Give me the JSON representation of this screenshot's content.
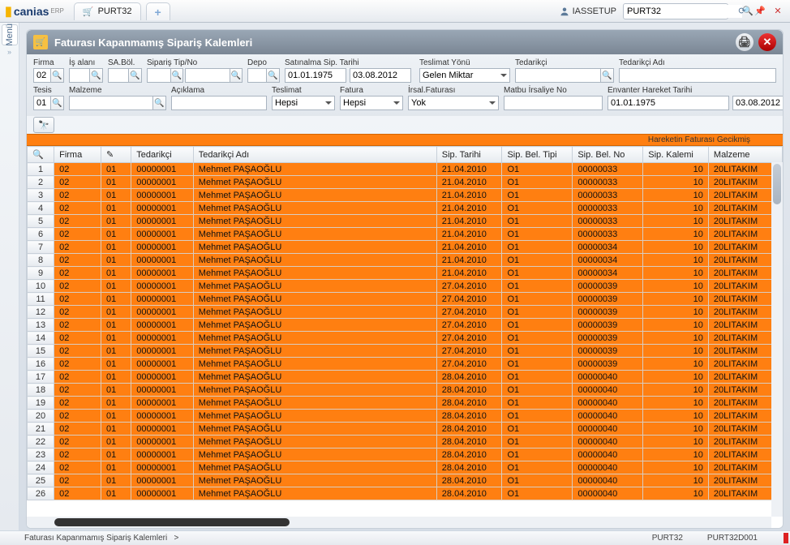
{
  "top": {
    "logo_text": "canias",
    "logo_sup": "ERP",
    "tab_label": "PURT32",
    "user": "IASSETUP",
    "search_value": "PURT32"
  },
  "menu": {
    "label": "Menü"
  },
  "panel": {
    "title": "Faturası Kapanmamış Sipariş Kalemleri"
  },
  "filters": {
    "row1": {
      "firma": {
        "label": "Firma",
        "value": "02"
      },
      "is_alani": {
        "label": "İş alanı",
        "value": ""
      },
      "sabol": {
        "label": "SA.Böl.",
        "value": ""
      },
      "siparis_tip_no": {
        "label": "Sipariş Tip/No",
        "value": ""
      },
      "depo": {
        "label": "Depo",
        "value": ""
      },
      "sat_sip_tarihi": {
        "label": "Satınalma Sip. Tarihi",
        "from": "01.01.1975",
        "to": "03.08.2012"
      },
      "teslimat_yonu": {
        "label": "Teslimat Yönü",
        "value": "Gelen Miktar"
      },
      "tedarikci": {
        "label": "Tedarikçi",
        "value": ""
      },
      "tedarikci_adi": {
        "label": "Tedarikçi Adı",
        "value": ""
      }
    },
    "row2": {
      "tesis": {
        "label": "Tesis",
        "value": "01"
      },
      "malzeme": {
        "label": "Malzeme",
        "value": ""
      },
      "aciklama": {
        "label": "Açıklama",
        "value": ""
      },
      "teslimat": {
        "label": "Teslimat",
        "value": "Hepsi"
      },
      "fatura": {
        "label": "Fatura",
        "value": "Hepsi"
      },
      "irsal_faturasi": {
        "label": "İrsal.Faturası",
        "value": "Yok"
      },
      "matbu_irsaliye_no": {
        "label": "Matbu İrsaliye No",
        "value": ""
      },
      "envanter_hareket_tarihi": {
        "label": "Envanter Hareket Tarihi",
        "from": "01.01.1975",
        "to": "03.08.2012"
      }
    }
  },
  "legend": "Hareketin Faturası Gecikmiş",
  "columns": {
    "firma": "Firma",
    "pencil": "✎",
    "tedarikci": "Tedarikçi",
    "tedarikci_adi": "Tedarikçi Adı",
    "sip_tarihi": "Sip. Tarihi",
    "sip_bel_tipi": "Sip. Bel. Tipi",
    "sip_bel_no": "Sip. Bel. No",
    "sip_kalemi": "Sip. Kalemi",
    "malzeme": "Malzeme"
  },
  "rows": [
    {
      "n": 1,
      "firma": "02",
      "p": "01",
      "ted": "00000001",
      "adi": "Mehmet PAŞAOĞLU",
      "tarih": "21.04.2010",
      "tip": "O1",
      "belno": "00000033",
      "kalem": "10",
      "mal": "20LITAKIM"
    },
    {
      "n": 2,
      "firma": "02",
      "p": "01",
      "ted": "00000001",
      "adi": "Mehmet PAŞAOĞLU",
      "tarih": "21.04.2010",
      "tip": "O1",
      "belno": "00000033",
      "kalem": "10",
      "mal": "20LITAKIM"
    },
    {
      "n": 3,
      "firma": "02",
      "p": "01",
      "ted": "00000001",
      "adi": "Mehmet PAŞAOĞLU",
      "tarih": "21.04.2010",
      "tip": "O1",
      "belno": "00000033",
      "kalem": "10",
      "mal": "20LITAKIM"
    },
    {
      "n": 4,
      "firma": "02",
      "p": "01",
      "ted": "00000001",
      "adi": "Mehmet PAŞAOĞLU",
      "tarih": "21.04.2010",
      "tip": "O1",
      "belno": "00000033",
      "kalem": "10",
      "mal": "20LITAKIM"
    },
    {
      "n": 5,
      "firma": "02",
      "p": "01",
      "ted": "00000001",
      "adi": "Mehmet PAŞAOĞLU",
      "tarih": "21.04.2010",
      "tip": "O1",
      "belno": "00000033",
      "kalem": "10",
      "mal": "20LITAKIM"
    },
    {
      "n": 6,
      "firma": "02",
      "p": "01",
      "ted": "00000001",
      "adi": "Mehmet PAŞAOĞLU",
      "tarih": "21.04.2010",
      "tip": "O1",
      "belno": "00000033",
      "kalem": "10",
      "mal": "20LITAKIM"
    },
    {
      "n": 7,
      "firma": "02",
      "p": "01",
      "ted": "00000001",
      "adi": "Mehmet PAŞAOĞLU",
      "tarih": "21.04.2010",
      "tip": "O1",
      "belno": "00000034",
      "kalem": "10",
      "mal": "20LITAKIM"
    },
    {
      "n": 8,
      "firma": "02",
      "p": "01",
      "ted": "00000001",
      "adi": "Mehmet PAŞAOĞLU",
      "tarih": "21.04.2010",
      "tip": "O1",
      "belno": "00000034",
      "kalem": "10",
      "mal": "20LITAKIM"
    },
    {
      "n": 9,
      "firma": "02",
      "p": "01",
      "ted": "00000001",
      "adi": "Mehmet PAŞAOĞLU",
      "tarih": "21.04.2010",
      "tip": "O1",
      "belno": "00000034",
      "kalem": "10",
      "mal": "20LITAKIM"
    },
    {
      "n": 10,
      "firma": "02",
      "p": "01",
      "ted": "00000001",
      "adi": "Mehmet PAŞAOĞLU",
      "tarih": "27.04.2010",
      "tip": "O1",
      "belno": "00000039",
      "kalem": "10",
      "mal": "20LITAKIM"
    },
    {
      "n": 11,
      "firma": "02",
      "p": "01",
      "ted": "00000001",
      "adi": "Mehmet PAŞAOĞLU",
      "tarih": "27.04.2010",
      "tip": "O1",
      "belno": "00000039",
      "kalem": "10",
      "mal": "20LITAKIM"
    },
    {
      "n": 12,
      "firma": "02",
      "p": "01",
      "ted": "00000001",
      "adi": "Mehmet PAŞAOĞLU",
      "tarih": "27.04.2010",
      "tip": "O1",
      "belno": "00000039",
      "kalem": "10",
      "mal": "20LITAKIM"
    },
    {
      "n": 13,
      "firma": "02",
      "p": "01",
      "ted": "00000001",
      "adi": "Mehmet PAŞAOĞLU",
      "tarih": "27.04.2010",
      "tip": "O1",
      "belno": "00000039",
      "kalem": "10",
      "mal": "20LITAKIM"
    },
    {
      "n": 14,
      "firma": "02",
      "p": "01",
      "ted": "00000001",
      "adi": "Mehmet PAŞAOĞLU",
      "tarih": "27.04.2010",
      "tip": "O1",
      "belno": "00000039",
      "kalem": "10",
      "mal": "20LITAKIM"
    },
    {
      "n": 15,
      "firma": "02",
      "p": "01",
      "ted": "00000001",
      "adi": "Mehmet PAŞAOĞLU",
      "tarih": "27.04.2010",
      "tip": "O1",
      "belno": "00000039",
      "kalem": "10",
      "mal": "20LITAKIM"
    },
    {
      "n": 16,
      "firma": "02",
      "p": "01",
      "ted": "00000001",
      "adi": "Mehmet PAŞAOĞLU",
      "tarih": "27.04.2010",
      "tip": "O1",
      "belno": "00000039",
      "kalem": "10",
      "mal": "20LITAKIM"
    },
    {
      "n": 17,
      "firma": "02",
      "p": "01",
      "ted": "00000001",
      "adi": "Mehmet PAŞAOĞLU",
      "tarih": "28.04.2010",
      "tip": "O1",
      "belno": "00000040",
      "kalem": "10",
      "mal": "20LITAKIM"
    },
    {
      "n": 18,
      "firma": "02",
      "p": "01",
      "ted": "00000001",
      "adi": "Mehmet PAŞAOĞLU",
      "tarih": "28.04.2010",
      "tip": "O1",
      "belno": "00000040",
      "kalem": "10",
      "mal": "20LITAKIM"
    },
    {
      "n": 19,
      "firma": "02",
      "p": "01",
      "ted": "00000001",
      "adi": "Mehmet PAŞAOĞLU",
      "tarih": "28.04.2010",
      "tip": "O1",
      "belno": "00000040",
      "kalem": "10",
      "mal": "20LITAKIM"
    },
    {
      "n": 20,
      "firma": "02",
      "p": "01",
      "ted": "00000001",
      "adi": "Mehmet PAŞAOĞLU",
      "tarih": "28.04.2010",
      "tip": "O1",
      "belno": "00000040",
      "kalem": "10",
      "mal": "20LITAKIM"
    },
    {
      "n": 21,
      "firma": "02",
      "p": "01",
      "ted": "00000001",
      "adi": "Mehmet PAŞAOĞLU",
      "tarih": "28.04.2010",
      "tip": "O1",
      "belno": "00000040",
      "kalem": "10",
      "mal": "20LITAKIM"
    },
    {
      "n": 22,
      "firma": "02",
      "p": "01",
      "ted": "00000001",
      "adi": "Mehmet PAŞAOĞLU",
      "tarih": "28.04.2010",
      "tip": "O1",
      "belno": "00000040",
      "kalem": "10",
      "mal": "20LITAKIM"
    },
    {
      "n": 23,
      "firma": "02",
      "p": "01",
      "ted": "00000001",
      "adi": "Mehmet PAŞAOĞLU",
      "tarih": "28.04.2010",
      "tip": "O1",
      "belno": "00000040",
      "kalem": "10",
      "mal": "20LITAKIM"
    },
    {
      "n": 24,
      "firma": "02",
      "p": "01",
      "ted": "00000001",
      "adi": "Mehmet PAŞAOĞLU",
      "tarih": "28.04.2010",
      "tip": "O1",
      "belno": "00000040",
      "kalem": "10",
      "mal": "20LITAKIM"
    },
    {
      "n": 25,
      "firma": "02",
      "p": "01",
      "ted": "00000001",
      "adi": "Mehmet PAŞAOĞLU",
      "tarih": "28.04.2010",
      "tip": "O1",
      "belno": "00000040",
      "kalem": "10",
      "mal": "20LITAKIM"
    },
    {
      "n": 26,
      "firma": "02",
      "p": "01",
      "ted": "00000001",
      "adi": "Mehmet PAŞAOĞLU",
      "tarih": "28.04.2010",
      "tip": "O1",
      "belno": "00000040",
      "kalem": "10",
      "mal": "20LITAKIM"
    }
  ],
  "status": {
    "left": "Faturası Kapanmamış Sipariş Kalemleri",
    "chevron": ">",
    "code1": "PURT32",
    "code2": "PURT32D001"
  }
}
